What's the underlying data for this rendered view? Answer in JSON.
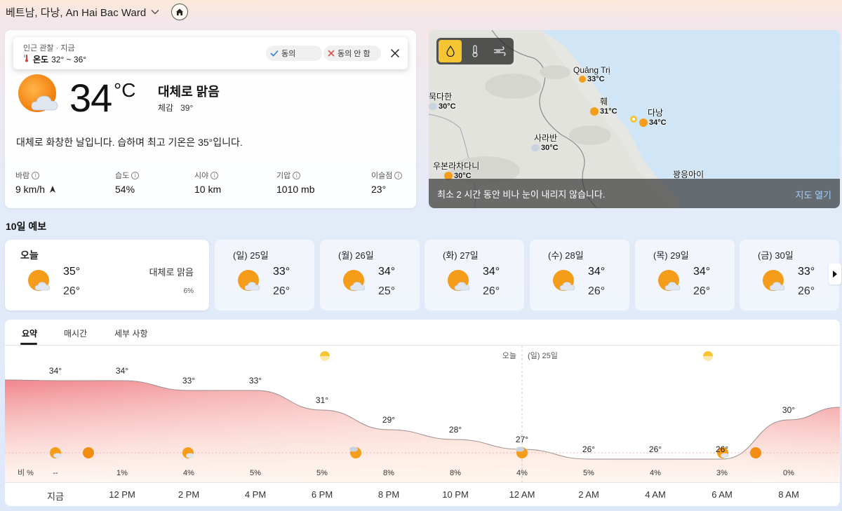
{
  "header": {
    "location": "베트남, 다낭, An Hai Bac Ward"
  },
  "current": {
    "popup": {
      "line1": "인근 관찰 · 지금",
      "label": "온도",
      "range": "32° ~ 36°",
      "agree": "동의",
      "disagree": "동의 안 함"
    },
    "temp": "34",
    "unit": "°C",
    "condition": "대체로 맑음",
    "feels_label": "체감",
    "feels_value": "39°",
    "description": "대체로 화창한 날입니다. 습하며 최고 기온은 35°입니다.",
    "stats": [
      {
        "label": "바람",
        "value": "9 km/h"
      },
      {
        "label": "습도",
        "value": "54%"
      },
      {
        "label": "시야",
        "value": "10 km"
      },
      {
        "label": "기압",
        "value": "1010 mb"
      },
      {
        "label": "이슬점",
        "value": "23°"
      }
    ]
  },
  "map": {
    "cities": [
      {
        "name": "Quảng Trị",
        "temp": "33°C"
      },
      {
        "name": "훼",
        "temp": "31°C"
      },
      {
        "name": "다낭",
        "temp": "34°C"
      },
      {
        "name": "묵다한",
        "temp": "30°C"
      },
      {
        "name": "사라반",
        "temp": "30°C"
      },
      {
        "name": "우본라차다니",
        "temp": "30°C"
      },
      {
        "name": "꽝응아이",
        "temp": ""
      }
    ],
    "message": "최소 2 시간 동안 비나 눈이 내리지 않습니다.",
    "open_label": "지도 열기"
  },
  "forecast": {
    "title": "10일 예보",
    "days": [
      {
        "label": "오늘",
        "hi": "35°",
        "lo": "26°",
        "cond": "대체로 맑음",
        "precip": "6%"
      },
      {
        "label": "(일) 25일",
        "hi": "33°",
        "lo": "26°"
      },
      {
        "label": "(월) 26일",
        "hi": "34°",
        "lo": "25°"
      },
      {
        "label": "(화) 27일",
        "hi": "34°",
        "lo": "26°"
      },
      {
        "label": "(수) 28일",
        "hi": "34°",
        "lo": "26°"
      },
      {
        "label": "(목) 29일",
        "hi": "34°",
        "lo": "26°"
      },
      {
        "label": "(금) 30일",
        "hi": "33°",
        "lo": "26°"
      }
    ]
  },
  "chart": {
    "tabs": [
      "요약",
      "매시간",
      "세부 사항"
    ],
    "today_label": "오늘",
    "next_day_label": "(일) 25일",
    "precip_label": "비 %",
    "times": [
      "지금",
      "12 PM",
      "2 PM",
      "4 PM",
      "6 PM",
      "8 PM",
      "10 PM",
      "12 AM",
      "2 AM",
      "4 AM",
      "6 AM",
      "8 AM"
    ],
    "temps": [
      "34°",
      "34°",
      "33°",
      "33°",
      "31°",
      "29°",
      "28°",
      "27°",
      "26°",
      "26°",
      "26°",
      "30°"
    ],
    "precip": [
      "--",
      "1%",
      "4%",
      "5%",
      "5%",
      "8%",
      "8%",
      "4%",
      "5%",
      "4%",
      "3%",
      "0%"
    ]
  },
  "chart_data": {
    "type": "area",
    "x": [
      "지금",
      "12 PM",
      "2 PM",
      "4 PM",
      "6 PM",
      "8 PM",
      "10 PM",
      "12 AM",
      "2 AM",
      "4 AM",
      "6 AM",
      "8 AM"
    ],
    "series": [
      {
        "values": [
          34,
          34,
          33,
          33,
          31,
          29,
          28,
          27,
          26,
          26,
          26,
          30
        ]
      }
    ],
    "precip_percent": [
      null,
      1,
      4,
      5,
      5,
      8,
      8,
      4,
      5,
      4,
      3,
      0
    ],
    "ylim": [
      20,
      36
    ]
  },
  "colors": {
    "accent": "#f7c531",
    "sun": "#f59d1a",
    "chart_fill_top": "#f08a8a",
    "map_water": "#cfe6f7"
  }
}
